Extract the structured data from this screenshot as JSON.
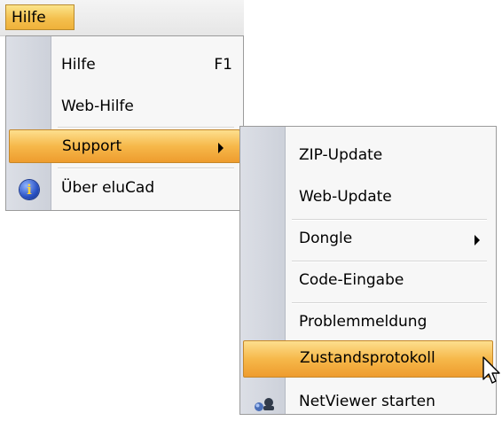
{
  "menubar": {
    "active_menu": "Hilfe"
  },
  "main_menu": {
    "items": [
      {
        "label": "Hilfe",
        "shortcut": "F1"
      },
      {
        "label": "Web-Hilfe"
      },
      {
        "label": "Support"
      },
      {
        "label": "Über eluCad",
        "icon": "info-icon"
      }
    ]
  },
  "submenu": {
    "items": [
      {
        "label": "ZIP-Update"
      },
      {
        "label": "Web-Update"
      },
      {
        "label": "Dongle"
      },
      {
        "label": "Code-Eingabe"
      },
      {
        "label": "Problemmeldung"
      },
      {
        "label": "Zustandsprotokoll"
      },
      {
        "label": "NetViewer starten",
        "icon": "netviewer-icon"
      }
    ]
  },
  "colors": {
    "highlight": "#f6b84a",
    "gutter": "#d3d6de"
  }
}
